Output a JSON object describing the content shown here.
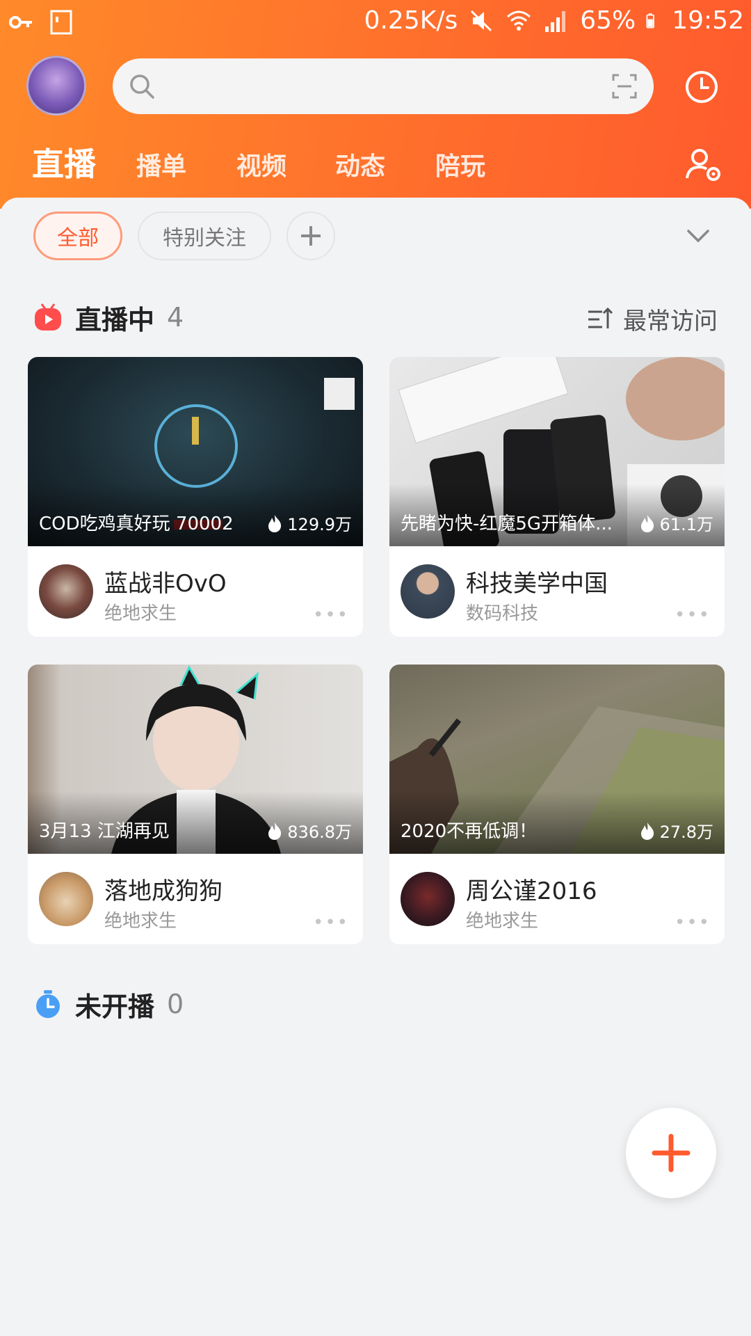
{
  "status_bar": {
    "net_speed": "0.25K/s",
    "battery": "65%",
    "time": "19:52"
  },
  "top_tabs": [
    "直播",
    "播单",
    "视频",
    "动态",
    "陪玩"
  ],
  "filter_chips": [
    "全部",
    "特别关注"
  ],
  "live_section": {
    "title": "直播中",
    "count": "4",
    "sort_label": "最常访问"
  },
  "cards": [
    {
      "title": "COD吃鸡真好玩 70002",
      "heat": "129.9万",
      "name": "蓝战非OvO",
      "category": "绝地求生"
    },
    {
      "title": "先睹为快-红魔5G开箱体...",
      "heat": "61.1万",
      "name": "科技美学中国",
      "category": "数码科技"
    },
    {
      "title": "3月13 江湖再见",
      "heat": "836.8万",
      "name": "落地成狗狗",
      "category": "绝地求生"
    },
    {
      "title": "2020不再低调！",
      "heat": "27.8万",
      "name": "周公谨2016",
      "category": "绝地求生"
    }
  ],
  "offline_section": {
    "title": "未开播",
    "count": "0"
  },
  "colors": {
    "accent": "#ff5a2d",
    "header_gradient_start": "#ff8a2a"
  }
}
